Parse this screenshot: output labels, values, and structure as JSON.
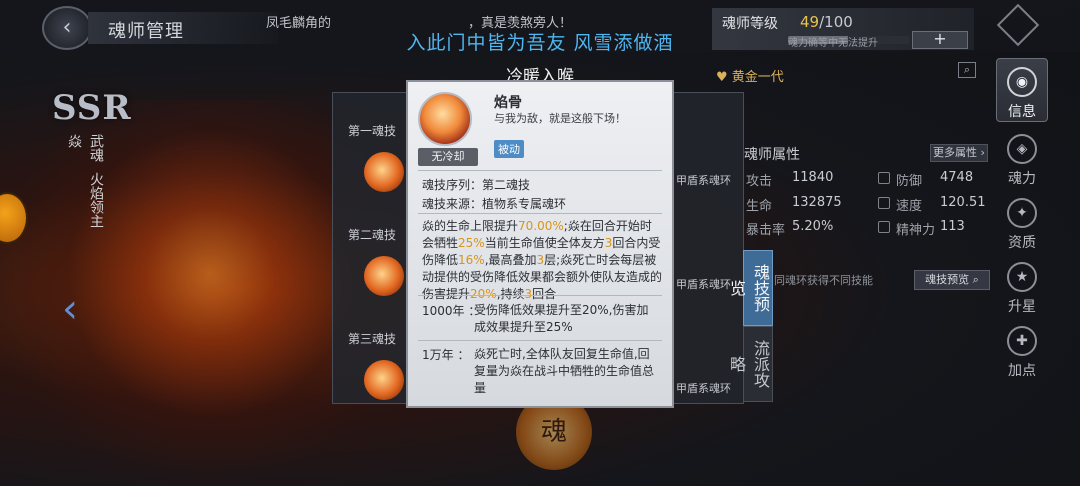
{
  "header": {
    "back_icon": "chevron-left-icon",
    "title": "魂师管理",
    "marquee_left": "凤毛麟角的",
    "marquee_right": "，真是羡煞旁人！"
  },
  "overlay_caption": "入此门中皆为吾友 风雪添做酒",
  "skin_name": "冷暖入喉",
  "level": {
    "label": "魂师等级",
    "current": "49",
    "max": "/100",
    "fraction": 0.49,
    "hint": "魂力确等中无法提升",
    "plus": "+"
  },
  "hero": {
    "rarity": "SSR",
    "name": "焱",
    "wuhun_label": "武魂",
    "wuhun_name": "火焰领主",
    "tier": "黄金一代"
  },
  "skills": {
    "rows": [
      "第一魂技",
      "第二魂技",
      "第三魂技"
    ],
    "ring_label": "甲盾系魂环"
  },
  "stats": {
    "title": "魂师属性",
    "more": "更多属性",
    "items": [
      {
        "label": "攻击",
        "value": "11840"
      },
      {
        "label": "防御",
        "value": "4748"
      },
      {
        "label": "生命",
        "value": "132875"
      },
      {
        "label": "速度",
        "value": "120.51"
      },
      {
        "label": "暴击率",
        "value": "5.20%"
      },
      {
        "label": "精神力",
        "value": "113"
      }
    ]
  },
  "side_tabs": {
    "preview": "魂技预览",
    "school": "流派攻略",
    "hint": "同魂环获得不同技能",
    "preview_btn": "魂技预览"
  },
  "right_nav": [
    {
      "label": "信息",
      "icon": "info-icon"
    },
    {
      "label": "魂力",
      "icon": "soul-power-icon"
    },
    {
      "label": "资质",
      "icon": "aptitude-icon"
    },
    {
      "label": "升星",
      "icon": "star-icon"
    },
    {
      "label": "加点",
      "icon": "plus-point-icon"
    }
  ],
  "seal_text": "魂",
  "popup": {
    "name": "焰骨",
    "quote": "与我为敌，就是这般下场！",
    "cooldown": "无冷却",
    "type": "被动",
    "seq_label": "魂技序列：",
    "seq_value": "第二魂技",
    "src_label": "魂技来源：",
    "src_value": "植物系专属魂环",
    "desc": {
      "p1": "焱的生命上限提升",
      "h1": "70.00%",
      "p2": ";焱在回合开始时会牺牲",
      "h2": "25%",
      "p3": "当前生命值使全体友方",
      "h3": "3",
      "p4": "回合内受伤降低",
      "h4": "16%",
      "p5": ",最高叠加",
      "h5": "3",
      "p6": "层;焱死亡时会每层被动提供的受伤降低效果都会额外使队友造成的伤害提升",
      "h6": "20%",
      "p7": ",持续",
      "h7": "3",
      "p8": "回合"
    },
    "year1000_label": "1000年 ：",
    "year1000_text": "受伤降低效果提升至20%,伤害加成效果提升至25%",
    "year10000_label": "1万年 ：",
    "year10000_text": "焱死亡时,全体队友回复生命值,回复量为焱在战斗中牺牲的生命值总量"
  }
}
